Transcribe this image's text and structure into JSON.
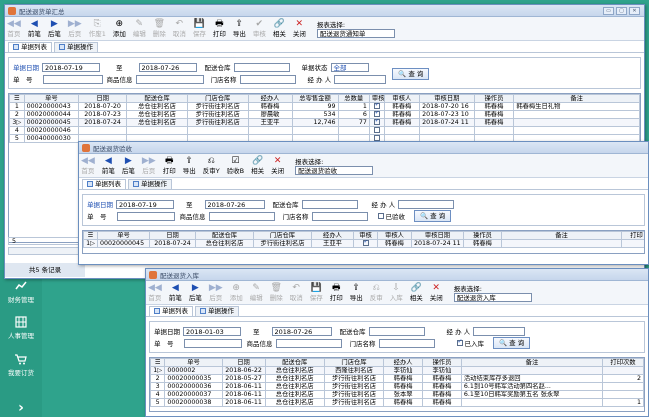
{
  "win1": {
    "title": "配送退货单汇总",
    "toolbar": [
      {
        "id": "first",
        "glyph": "◀◀",
        "label": "首页",
        "enabled": false
      },
      {
        "id": "prev",
        "glyph": "◀",
        "label": "前笔",
        "enabled": true
      },
      {
        "id": "next",
        "glyph": "▶",
        "label": "后笔",
        "enabled": true
      },
      {
        "id": "last",
        "glyph": "▶▶",
        "label": "后页",
        "enabled": false
      },
      {
        "id": "void",
        "glyph": "⎘",
        "label": "作废1",
        "enabled": false
      },
      {
        "id": "add",
        "glyph": "⊕",
        "label": "添加",
        "enabled": true
      },
      {
        "id": "edit",
        "glyph": "✎",
        "label": "编辑",
        "enabled": false
      },
      {
        "id": "delete",
        "glyph": "🗑",
        "label": "删除",
        "enabled": false
      },
      {
        "id": "cancel",
        "glyph": "↶",
        "label": "取消",
        "enabled": false
      },
      {
        "id": "save",
        "glyph": "💾",
        "label": "保存",
        "enabled": false
      },
      {
        "id": "print",
        "glyph": "🖶",
        "label": "打印",
        "enabled": true
      },
      {
        "id": "export",
        "glyph": "⇪",
        "label": "导出",
        "enabled": true
      },
      {
        "id": "audit",
        "glyph": "✔",
        "label": "审核",
        "enabled": false
      },
      {
        "id": "related",
        "glyph": "🔗",
        "label": "相关",
        "enabled": true
      },
      {
        "id": "close",
        "glyph": "✕",
        "label": "关闭",
        "enabled": true
      }
    ],
    "report_label": "报表选择:",
    "report_value": "配送退货通知单",
    "tabs": [
      "单据列表",
      "单据操作"
    ],
    "q_date_label": "单据日期",
    "q_date_from": "2018-07-19",
    "q_to": "至",
    "q_date_to": "2018-07-26",
    "q_wh_label": "配送仓库",
    "q_status_label": "单据状态",
    "q_status_value": "全部",
    "q_no_label": "单　号",
    "q_goods_label": "商品信息",
    "q_store_label": "门店名称",
    "q_agent_label": "经 办 人",
    "q_btn": "查 询",
    "columns": [
      "单号",
      "日期",
      "配送仓库",
      "门店仓库",
      "经办人",
      "总零售金额",
      "总数量",
      "审核",
      "审核人",
      "审核日期",
      "操作员",
      "备注"
    ],
    "rows": [
      {
        "idx": "1",
        "no": "00020000043",
        "date": "2018-07-20",
        "wh": "总仓往利名店",
        "store": "步行街往利名店",
        "agent": "韩春梅",
        "amt": "99",
        "qty": "1",
        "audit": true,
        "auditor": "韩春梅",
        "adate": "2018-07-20 16",
        "op": "韩春梅",
        "memo": "韩春梅生日礼物"
      },
      {
        "idx": "2",
        "no": "00020000044",
        "date": "2018-07-23",
        "wh": "总仓往利名店",
        "store": "步行街往利名店",
        "agent": "廖晨敏",
        "amt": "534",
        "qty": "6",
        "audit": true,
        "auditor": "韩春梅",
        "adate": "2018-07-23 10",
        "op": "韩春梅",
        "memo": ""
      },
      {
        "idx": "3▷",
        "no": "00020000045",
        "date": "2018-07-24",
        "wh": "总仓往利名店",
        "store": "步行街往利名店",
        "agent": "王亚平",
        "amt": "12,746",
        "qty": "77",
        "audit": true,
        "auditor": "韩春梅",
        "adate": "2018-07-24 11",
        "op": "韩春梅",
        "memo": ""
      },
      {
        "idx": "4",
        "no": "00020000046",
        "date": "",
        "wh": "",
        "store": "",
        "agent": "",
        "amt": "",
        "qty": "",
        "audit": false,
        "auditor": "",
        "adate": "",
        "op": "",
        "memo": ""
      },
      {
        "idx": "5",
        "no": "00040000030",
        "date": "",
        "wh": "",
        "store": "",
        "agent": "",
        "amt": "",
        "qty": "",
        "audit": false,
        "auditor": "",
        "adate": "",
        "op": "",
        "memo": ""
      }
    ],
    "footer_count": "5",
    "total": "共5 条记录"
  },
  "win2": {
    "title": "配送退货验收",
    "toolbar": [
      {
        "id": "first",
        "glyph": "◀◀",
        "label": "首页",
        "enabled": false
      },
      {
        "id": "prev",
        "glyph": "◀",
        "label": "前笔",
        "enabled": true
      },
      {
        "id": "next",
        "glyph": "▶",
        "label": "后笔",
        "enabled": true
      },
      {
        "id": "last",
        "glyph": "▶▶",
        "label": "后页",
        "enabled": false
      },
      {
        "id": "print",
        "glyph": "🖶",
        "label": "打印",
        "enabled": true
      },
      {
        "id": "export",
        "glyph": "⇪",
        "label": "导出",
        "enabled": true
      },
      {
        "id": "reaudit",
        "glyph": "⎌",
        "label": "反审Y",
        "enabled": true
      },
      {
        "id": "check",
        "glyph": "☑",
        "label": "验收B",
        "enabled": true
      },
      {
        "id": "related",
        "glyph": "🔗",
        "label": "相关",
        "enabled": true
      },
      {
        "id": "close",
        "glyph": "✕",
        "label": "关闭",
        "enabled": true
      }
    ],
    "report_label": "报表选择:",
    "report_value": "配送退货验收",
    "tabs": [
      "单据列表",
      "单据操作"
    ],
    "q_date_label": "单据日期",
    "q_date_from": "2018-07-19",
    "q_to": "至",
    "q_date_to": "2018-07-26",
    "q_wh_label": "配送仓库",
    "q_agent_label": "经 办 人",
    "q_no_label": "单　号",
    "q_goods_label": "商品信息",
    "q_store_label": "门店名称",
    "q_check_label": "已验收",
    "q_btn": "查 询",
    "columns": [
      "单号",
      "日期",
      "配送仓库",
      "门店仓库",
      "经办人",
      "审核",
      "审核人",
      "审核日期",
      "操作员",
      "备注",
      "打印"
    ],
    "rows": [
      {
        "idx": "1▷",
        "no": "00020000045",
        "date": "2018-07-24",
        "wh": "总仓往利名店",
        "store": "步行街往利名店",
        "agent": "王亚平",
        "audit": true,
        "auditor": "韩春梅",
        "adate": "2018-07-24 11",
        "op": "韩春梅",
        "memo": "",
        "print": ""
      }
    ]
  },
  "win3": {
    "title": "配送退货入库",
    "toolbar": [
      {
        "id": "first",
        "glyph": "◀◀",
        "label": "首页",
        "enabled": false
      },
      {
        "id": "prev",
        "glyph": "◀",
        "label": "前笔",
        "enabled": true
      },
      {
        "id": "next",
        "glyph": "▶",
        "label": "后笔",
        "enabled": true
      },
      {
        "id": "last",
        "glyph": "▶▶",
        "label": "后页",
        "enabled": false
      },
      {
        "id": "add",
        "glyph": "⊕",
        "label": "添加",
        "enabled": false
      },
      {
        "id": "edit",
        "glyph": "✎",
        "label": "编辑",
        "enabled": false
      },
      {
        "id": "delete",
        "glyph": "🗑",
        "label": "删除",
        "enabled": false
      },
      {
        "id": "cancel",
        "glyph": "↶",
        "label": "取消",
        "enabled": false
      },
      {
        "id": "save",
        "glyph": "💾",
        "label": "保存",
        "enabled": false
      },
      {
        "id": "print",
        "glyph": "🖶",
        "label": "打印",
        "enabled": true
      },
      {
        "id": "export",
        "glyph": "⇪",
        "label": "导出",
        "enabled": true
      },
      {
        "id": "reaudit",
        "glyph": "⎌",
        "label": "反审",
        "enabled": false
      },
      {
        "id": "instock",
        "glyph": "⇩",
        "label": "入库",
        "enabled": false
      },
      {
        "id": "related",
        "glyph": "🔗",
        "label": "相关",
        "enabled": true
      },
      {
        "id": "close",
        "glyph": "✕",
        "label": "关闭",
        "enabled": true
      }
    ],
    "report_label": "报表选择:",
    "report_value": "配送退货入库",
    "tabs": [
      "单据列表",
      "单据操作"
    ],
    "q_date_label": "单据日期",
    "q_date_from": "2018-01-03",
    "q_to": "至",
    "q_date_to": "2018-07-26",
    "q_wh_label": "配送仓库",
    "q_agent_label": "经 办 人",
    "q_no_label": "单　号",
    "q_goods_label": "商品信息",
    "q_store_label": "门店名称",
    "q_in_label": "已入库",
    "q_btn": "查 询",
    "columns": [
      "单号",
      "日期",
      "配送仓库",
      "门店仓库",
      "经办人",
      "操作员",
      "备注",
      "打印次数"
    ],
    "rows": [
      {
        "idx": "1▷",
        "no": "0000002",
        "date": "2018-06-22",
        "wh": "总仓往利名店",
        "store": "西隆往利名店",
        "agent": "李钫仙",
        "op": "李钫仙",
        "memo": "",
        "print": ""
      },
      {
        "idx": "2",
        "no": "00020000035",
        "date": "2018-05-27",
        "wh": "总仓往利名店",
        "store": "步行街往利名店",
        "agent": "韩春梅",
        "op": "韩春梅",
        "memo": "活动结束库存多退回",
        "print": "2"
      },
      {
        "idx": "3",
        "no": "00020000036",
        "date": "2018-06-11",
        "wh": "总仓往利名店",
        "store": "步行街往利名店",
        "agent": "韩春梅",
        "op": "韩春梅",
        "memo": "6.1到10号韩军活动第四名赵...",
        "print": ""
      },
      {
        "idx": "4",
        "no": "00020000037",
        "date": "2018-06-11",
        "wh": "总仓往利名店",
        "store": "步行街往利名店",
        "agent": "张本翠",
        "op": "韩春梅",
        "memo": "6.1至10日韩军奖励第五名 张永翠",
        "print": ""
      },
      {
        "idx": "5",
        "no": "00020000038",
        "date": "2018-06-11",
        "wh": "总仓往利名店",
        "store": "步行街往利名店",
        "agent": "韩春梅",
        "op": "韩春梅",
        "memo": "",
        "print": "1"
      }
    ]
  },
  "sidebar": [
    {
      "icon": "finance-icon",
      "label": "财务管理"
    },
    {
      "icon": "hr-icon",
      "label": "人事管理"
    },
    {
      "icon": "cart-icon",
      "label": "我要订货"
    }
  ],
  "colors": {
    "desktop": "#2fa38c",
    "titlebar": "#c6d6ec",
    "accent": "#1e4fb2"
  }
}
